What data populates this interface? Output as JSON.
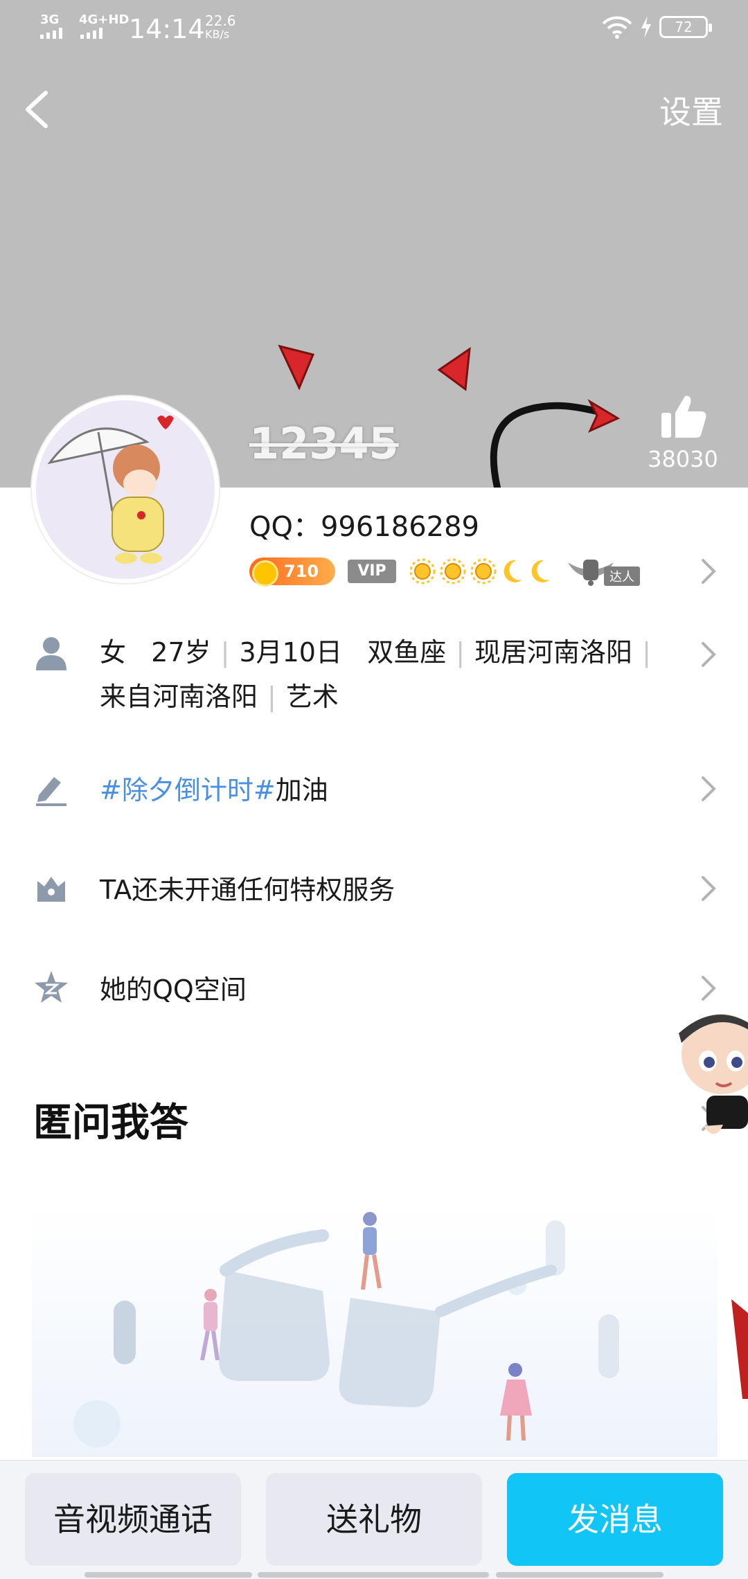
{
  "status_bar": {
    "network_1": "3G",
    "network_2": "4G+HD",
    "time": "14:14",
    "speed_value": "22.6",
    "speed_unit": "KB/s",
    "battery": "72"
  },
  "header": {
    "settings_label": "设置",
    "nickname": "12345",
    "like_count": "38030"
  },
  "profile": {
    "qq_line": "QQ：996186289",
    "level_badge_text": "710",
    "vip_label": "VIP",
    "expert_label": "达人"
  },
  "info": {
    "gender": "女",
    "age": "27岁",
    "birthday": "3月10日",
    "zodiac": "双鱼座",
    "residence": "现居河南洛阳",
    "hometown": "来自河南洛阳",
    "profession": "艺术"
  },
  "signature": {
    "hashtag": "#除夕倒计时#",
    "text": "加油"
  },
  "privilege_text": "TA还未开通任何特权服务",
  "qzone_text": "她的QQ空间",
  "section": {
    "title": "匿问我答"
  },
  "bottom": {
    "call_label": "音视频通话",
    "gift_label": "送礼物",
    "message_label": "发消息"
  },
  "colors": {
    "accent": "#12c5f7",
    "link": "#4a90e2",
    "cover_bg": "#bdbdbd"
  }
}
